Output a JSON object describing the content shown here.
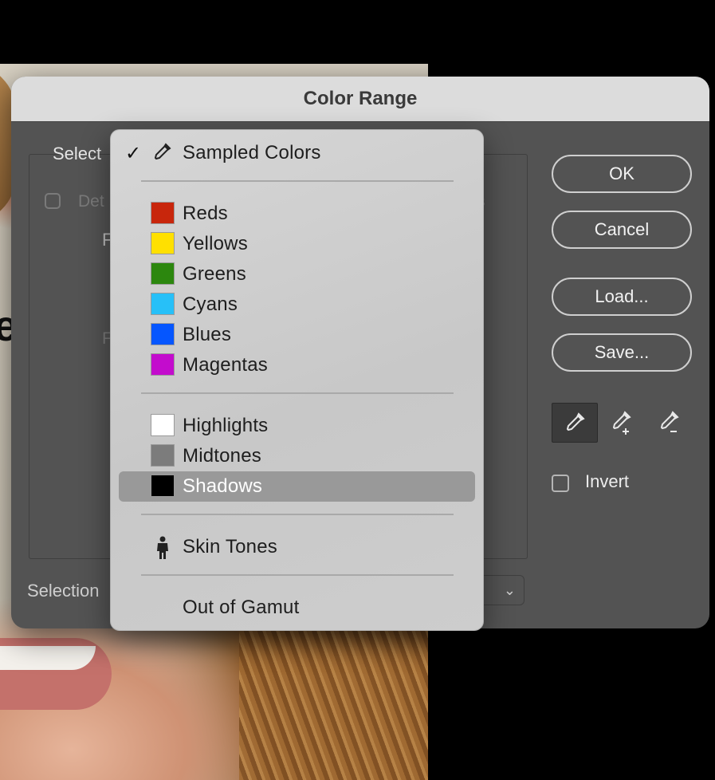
{
  "dialog": {
    "title": "Color Range",
    "select_label": "Select",
    "detect_partial": "Det",
    "right_partial": "s",
    "f_partial_1": "F",
    "f_partial_2": "F",
    "selection_label": "Selection"
  },
  "buttons": {
    "ok": "OK",
    "cancel": "Cancel",
    "load": "Load...",
    "save": "Save..."
  },
  "tools": [
    "eyedropper-icon",
    "eyedropper-plus-icon",
    "eyedropper-minus-icon"
  ],
  "invert_label": "Invert",
  "menu": {
    "sampled": {
      "label": "Sampled Colors",
      "checked": true,
      "icon": "eyedropper-icon"
    },
    "colors": [
      {
        "label": "Reds",
        "color": "#c8260c"
      },
      {
        "label": "Yellows",
        "color": "#ffe000"
      },
      {
        "label": "Greens",
        "color": "#2c870e"
      },
      {
        "label": "Cyans",
        "color": "#27c0f8"
      },
      {
        "label": "Blues",
        "color": "#0556ff"
      },
      {
        "label": "Magentas",
        "color": "#c30ccd"
      }
    ],
    "tones": [
      {
        "label": "Highlights",
        "color": "#ffffff"
      },
      {
        "label": "Midtones",
        "color": "#7c7c7c"
      },
      {
        "label": "Shadows",
        "color": "#000000",
        "highlighted": true
      }
    ],
    "skin": {
      "label": "Skin Tones",
      "icon": "person-icon"
    },
    "gamut": {
      "label": "Out of Gamut"
    }
  },
  "photo_overlay_text": "e"
}
